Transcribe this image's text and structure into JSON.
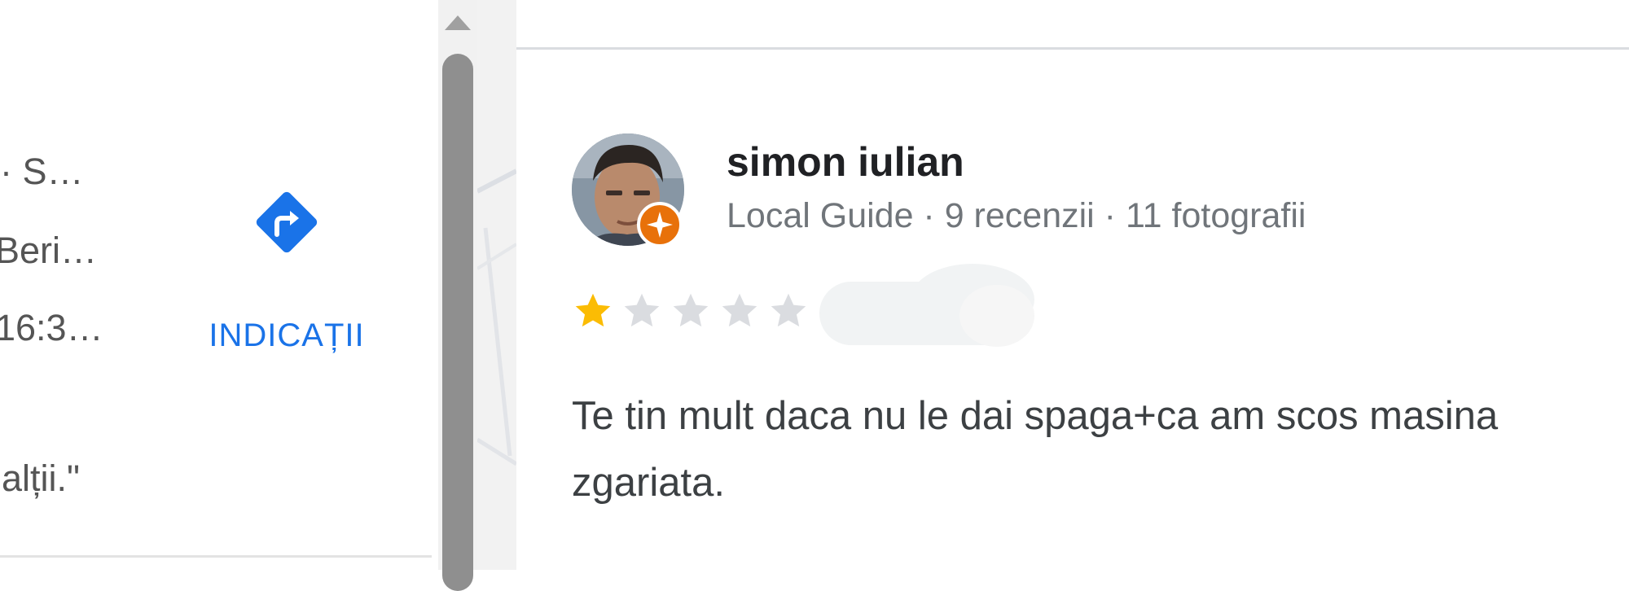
{
  "left_panel": {
    "lines": [
      " · S…",
      "Beri…",
      "16:3…",
      "alții.\""
    ]
  },
  "directions": {
    "label": "INDICAȚII",
    "icon": "directions-icon",
    "color": "#1a73e8"
  },
  "review": {
    "reviewer_name": "simon iulian",
    "reviewer_meta": "Local Guide · 9 recenzii · 11 fotografii",
    "badge_icon": "local-guide-badge-icon",
    "rating": 1,
    "rating_max": 5,
    "star_filled_color": "#fbbc04",
    "star_empty_color": "#dadce0",
    "date": "",
    "text_line_1": "Te tin mult daca nu le dai spaga+ca am scos masina",
    "text_line_2": "zgariata."
  }
}
